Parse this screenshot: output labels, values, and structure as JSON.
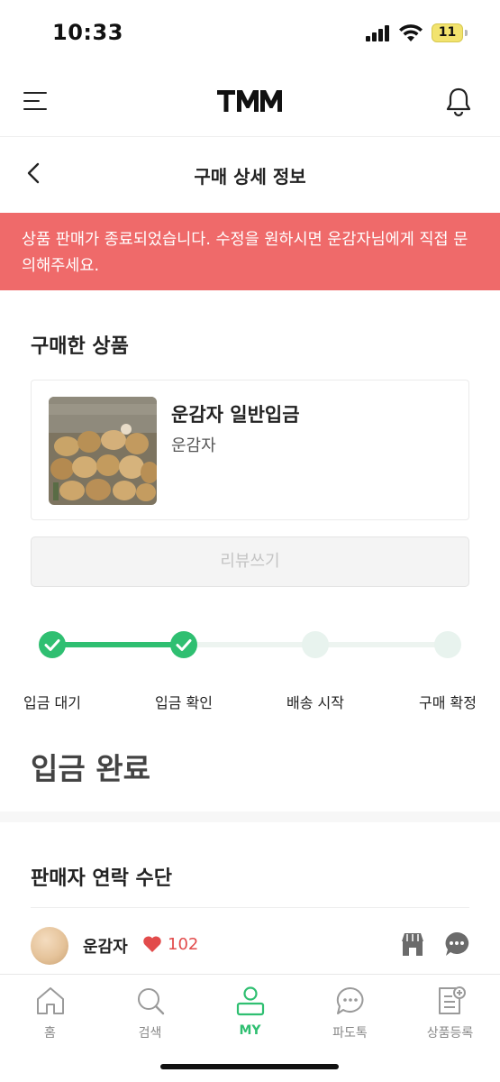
{
  "status_bar": {
    "time": "10:33",
    "battery": "11"
  },
  "header": {
    "logo_text": "TMM",
    "menu_icon": "menu-icon",
    "bell_icon": "bell-icon"
  },
  "page": {
    "title": "구매 상세 정보",
    "back_icon": "chevron-left-icon"
  },
  "notice": {
    "text": "상품 판매가 종료되었습니다. 수정을 원하시면 운감자님에게 직접 문의해주세요.",
    "color": "#ef6a6a"
  },
  "purchased": {
    "section_title": "구매한 상품",
    "product_name": "운감자 일반입금",
    "seller": "운감자",
    "review_button": "리뷰쓰기"
  },
  "progress": {
    "current_step": 2,
    "total_steps": 4,
    "steps": [
      "입금 대기",
      "입금 확인",
      "배송 시작",
      "구매 확정"
    ],
    "accent": "#2fbf71"
  },
  "status_heading": "입금 완료",
  "contact": {
    "section_title": "판매자 연락 수단",
    "seller_name": "운감자",
    "likes": "102",
    "heart_color": "#e24b4b"
  },
  "bottom_nav": {
    "items": [
      {
        "label": "홈",
        "icon": "home-icon"
      },
      {
        "label": "검색",
        "icon": "search-icon"
      },
      {
        "label": "MY",
        "icon": "user-icon"
      },
      {
        "label": "파도톡",
        "icon": "chat-bubble-icon"
      },
      {
        "label": "상품등록",
        "icon": "register-product-icon"
      }
    ],
    "active_index": 2
  }
}
